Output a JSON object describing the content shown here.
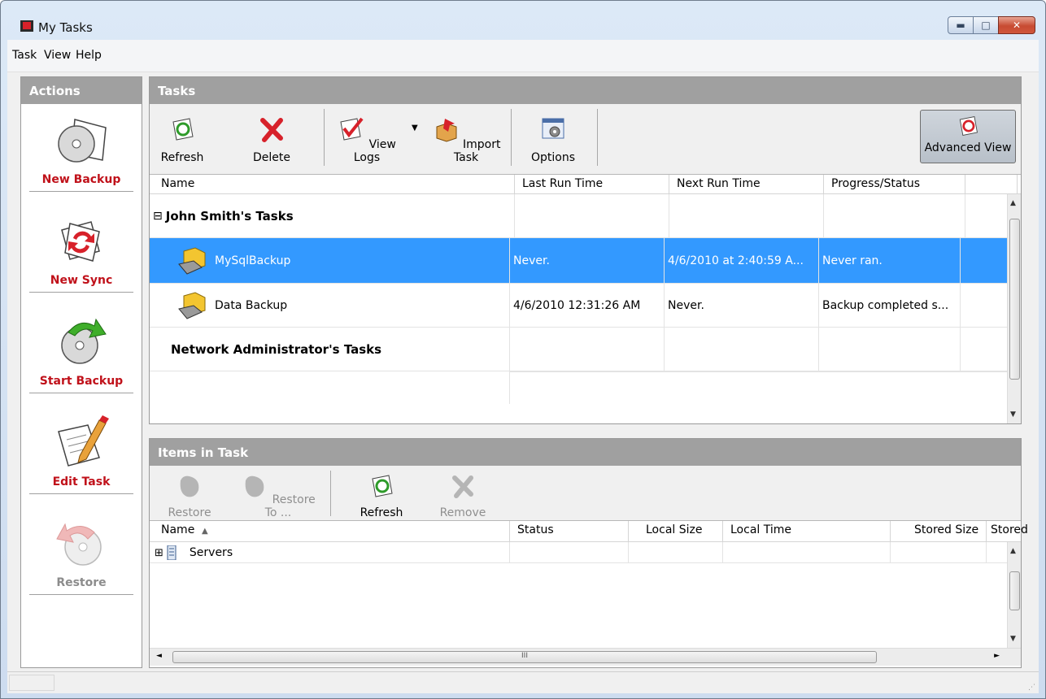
{
  "window": {
    "title": "My Tasks",
    "minimize": "▬",
    "maximize": "□",
    "close": "✕"
  },
  "menu": [
    "Task",
    "View",
    "Help"
  ],
  "actions": {
    "header": "Actions",
    "items": [
      {
        "label": "New Backup",
        "icon": "disc-backup-icon",
        "enabled": true
      },
      {
        "label": "New Sync",
        "icon": "sync-icon",
        "enabled": true
      },
      {
        "label": "Start Backup",
        "icon": "start-backup-icon",
        "enabled": true
      },
      {
        "label": "Edit Task",
        "icon": "edit-task-icon",
        "enabled": true
      },
      {
        "label": "Restore",
        "icon": "restore-icon",
        "enabled": false
      }
    ]
  },
  "tasks": {
    "header": "Tasks",
    "toolbar": {
      "refresh": "Refresh",
      "delete": "Delete",
      "view_logs": "View Logs",
      "import_task": "Import Task",
      "options": "Options",
      "advanced_view": "Advanced View"
    },
    "columns": [
      "Name",
      "Last Run Time",
      "Next Run Time",
      "Progress/Status"
    ],
    "groups": [
      {
        "title": "John Smith's Tasks",
        "toggle": "⊟"
      },
      {
        "title": "Network Administrator's Tasks"
      }
    ],
    "rows": [
      {
        "name": "MySqlBackup",
        "last_run": "Never.",
        "next_run": "4/6/2010 at 2:40:59 A...",
        "status": "Never ran.",
        "selected": true
      },
      {
        "name": "Data Backup",
        "last_run": "4/6/2010 12:31:26 AM",
        "next_run": "Never.",
        "status": "Backup completed s...",
        "selected": false
      }
    ]
  },
  "items_in_task": {
    "header": "Items in Task",
    "toolbar": {
      "restore": "Restore",
      "restore_to": "Restore To ...",
      "refresh": "Refresh",
      "remove": "Remove"
    },
    "columns": [
      "Name",
      "Status",
      "Local Size",
      "Local Time",
      "Stored Size",
      "Stored"
    ],
    "sort_indicator": "▲",
    "rows": [
      {
        "name": "Servers",
        "toggle": "⊞"
      }
    ],
    "hscroll_grip": "III"
  },
  "colors": {
    "accent_red": "#c0111a",
    "selection": "#3399ff",
    "header_gray": "#a0a0a0"
  }
}
